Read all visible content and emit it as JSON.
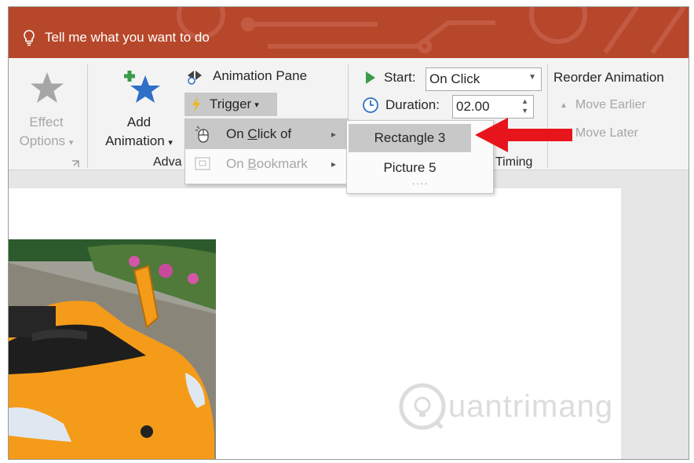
{
  "tell_me": {
    "text": "Tell me what you want to do"
  },
  "ribbon": {
    "effect_options": {
      "line1": "Effect",
      "line2": "Options",
      "arrow": "▾"
    },
    "add_animation": {
      "line1": "Add",
      "line2": "Animation",
      "arrow": "▾"
    },
    "animation_pane": "Animation Pane",
    "trigger": {
      "label": "Trigger",
      "arrow": "▾"
    },
    "group_label_advanced": "Adva",
    "start": {
      "label": "Start:",
      "value": "On Click"
    },
    "duration": {
      "label": "Duration:",
      "value": "02.00"
    },
    "group_label_timing": "Timing",
    "reorder": {
      "title": "Reorder Animation",
      "earlier": "Move Earlier",
      "later": "Move Later"
    }
  },
  "trigger_menu": {
    "items": [
      {
        "pre": "On ",
        "ul": "C",
        "post": "lick of",
        "arrow": "▸",
        "state": "highlighted"
      },
      {
        "pre": "On ",
        "ul": "B",
        "post": "ookmark",
        "arrow": "▸",
        "state": "disabled"
      }
    ]
  },
  "submenu": {
    "items": [
      "Rectangle 3",
      "Picture 5"
    ],
    "selected": "Rectangle 3",
    "grip": "····"
  },
  "watermark": "uantrimang",
  "colors": {
    "title_bar": "#b7472a",
    "arrow": "#e8141b",
    "accent_green": "#3a9a4a",
    "accent_blue": "#2f6fc7"
  }
}
